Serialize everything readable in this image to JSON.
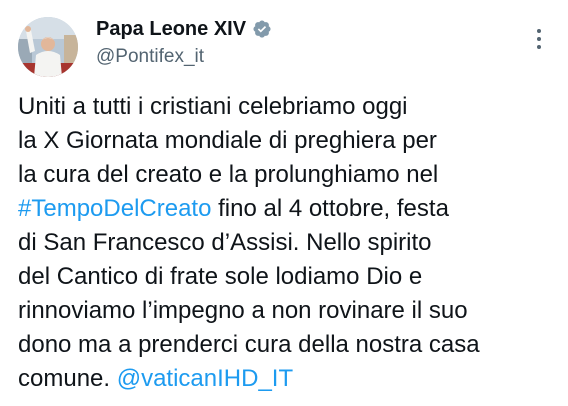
{
  "author": {
    "display_name": "Papa Leone XIV",
    "handle": "@Pontifex_it",
    "verified_icon": "verified-badge-icon",
    "verified_color": "#829aab"
  },
  "tweet": {
    "lines": [
      {
        "segments": [
          {
            "text": "Uniti a tutti i cristiani celebriamo oggi",
            "link": false
          }
        ]
      },
      {
        "segments": [
          {
            "text": "la X Giornata mondiale di preghiera per",
            "link": false
          }
        ]
      },
      {
        "segments": [
          {
            "text": "la cura del creato e la prolunghiamo nel",
            "link": false
          }
        ]
      },
      {
        "segments": [
          {
            "text": "#TempoDelCreato",
            "link": true
          },
          {
            "text": " fino al 4 ottobre, festa",
            "link": false
          }
        ]
      },
      {
        "segments": [
          {
            "text": "di San Francesco d’Assisi. Nello spirito",
            "link": false
          }
        ]
      },
      {
        "segments": [
          {
            "text": "del Cantico di frate sole lodiamo Dio e",
            "link": false
          }
        ]
      },
      {
        "segments": [
          {
            "text": "rinnoviamo l’impegno a non rovinare il suo",
            "link": false
          }
        ]
      },
      {
        "segments": [
          {
            "text": "dono ma a prenderci cura della nostra casa",
            "link": false
          }
        ]
      },
      {
        "segments": [
          {
            "text": "comune. ",
            "link": false
          },
          {
            "text": "@vaticanIHD_IT",
            "link": true
          }
        ]
      }
    ]
  },
  "icons": {
    "more": "more-options-icon",
    "avatar": "avatar-photo"
  },
  "colors": {
    "text": "#0f1419",
    "secondary": "#536471",
    "link": "#1d9bf0",
    "background": "#ffffff"
  }
}
